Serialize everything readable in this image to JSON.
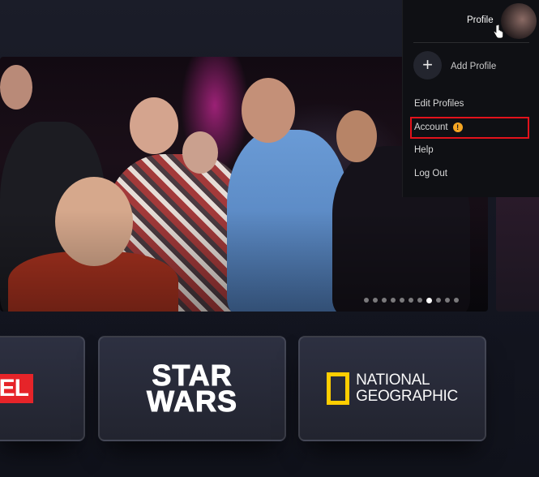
{
  "profile_menu": {
    "profile_label": "Profile",
    "add_profile_label": "Add Profile",
    "add_icon_glyph": "+",
    "items": [
      {
        "label": "Edit Profiles"
      },
      {
        "label": "Account",
        "badge": "!"
      },
      {
        "label": "Help"
      },
      {
        "label": "Log Out"
      }
    ]
  },
  "carousel": {
    "total_slides": 11,
    "active_index": 7
  },
  "brands": {
    "marvel": "VEL",
    "star_wars": [
      "STAR",
      "WARS"
    ],
    "national_geographic": [
      "NATIONAL",
      "GEOGRAPHIC"
    ]
  },
  "colors": {
    "accent_highlight": "#e2121b",
    "warning_badge": "#f5a623",
    "natgeo_yellow": "#ffce00",
    "marvel_red": "#e62429"
  },
  "icons": [
    "plus-icon",
    "warning-icon",
    "pointer-cursor-icon"
  ]
}
